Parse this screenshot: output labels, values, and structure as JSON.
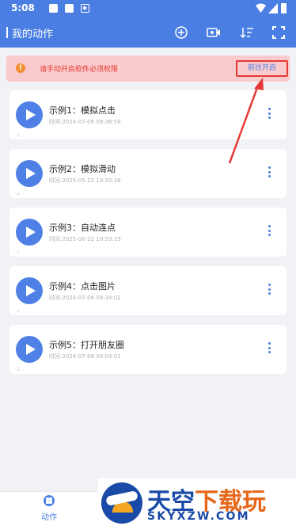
{
  "status_bar": {
    "time": "5:08"
  },
  "header": {
    "title": "我的动作",
    "icons": [
      "add-circle-icon",
      "video-camera-icon",
      "sort-icon",
      "expand-icon"
    ]
  },
  "alert": {
    "message": "请手动开启软件必须权限",
    "action_label": "前往开启",
    "accent": "#e53935"
  },
  "actions": [
    {
      "name": "示例1：模拟点击",
      "time": "时间:2024-07-06 09:36:56"
    },
    {
      "name": "示例2：模拟滑动",
      "time": "时间:2025-05-22 19:50:36"
    },
    {
      "name": "示例3：自动连点",
      "time": "时间:2025-06-22 19:53:19"
    },
    {
      "name": "示例4：点击图片",
      "time": "时间:2024-07-06 09:34:02"
    },
    {
      "name": "示例5：打开朋友圈",
      "time": "时间:2024-07-06 09:04:01"
    }
  ],
  "bottom_nav": {
    "item_label": "动作"
  },
  "watermark": {
    "title_blue": "天空",
    "title_orange": "下载玩",
    "url": "SKYXZW.COM"
  },
  "colors": {
    "primary": "#4a7ee3",
    "alert_bg": "#f9cbcc"
  }
}
